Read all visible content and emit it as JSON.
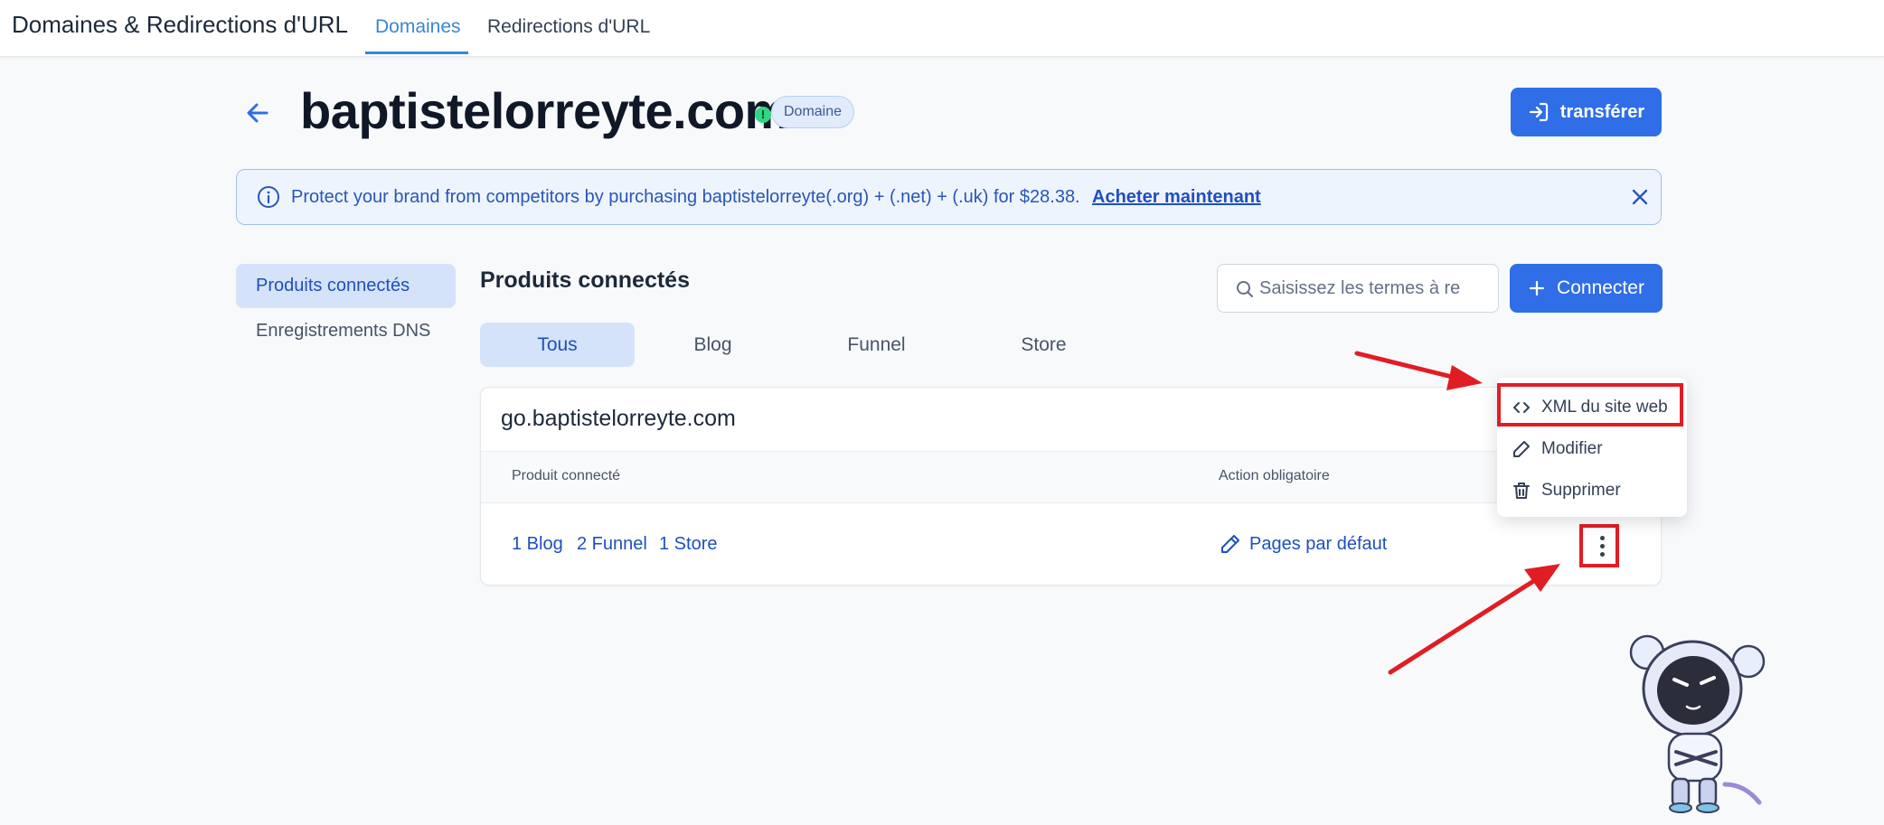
{
  "header": {
    "app_title": "Domaines & Redirections d'URL",
    "tabs": [
      {
        "label": "Domaines",
        "active": true
      },
      {
        "label": "Redirections d'URL",
        "active": false
      }
    ]
  },
  "domain": {
    "name": "baptistelorreyte.com",
    "status_icon": "warning-dot-icon",
    "badge": "Domaine",
    "transfer_label": "transférer"
  },
  "banner": {
    "text": "Protect your brand from competitors by purchasing baptistelorreyte(.org) + (.net) + (.uk) for $28.38.",
    "link": "Acheter maintenant"
  },
  "sidebar": {
    "items": [
      {
        "label": "Produits connectés",
        "active": true
      },
      {
        "label": "Enregistrements DNS",
        "active": false
      }
    ]
  },
  "main": {
    "title": "Produits connectés",
    "search_placeholder": "Saisissez les termes à re",
    "connect_label": "Connecter",
    "filters": [
      {
        "label": "Tous",
        "active": true
      },
      {
        "label": "Blog",
        "active": false
      },
      {
        "label": "Funnel",
        "active": false
      },
      {
        "label": "Store",
        "active": false
      }
    ]
  },
  "card": {
    "domain": "go.baptistelorreyte.com",
    "columns": {
      "product": "Produit connecté",
      "action": "Action obligatoire"
    },
    "products": [
      {
        "label": "1 Blog"
      },
      {
        "label": "2 Funnel"
      },
      {
        "label": "1 Store"
      }
    ],
    "action_label": "Pages par défaut"
  },
  "menu": {
    "items": [
      {
        "label": "XML du site web",
        "icon": "code-icon"
      },
      {
        "label": "Modifier",
        "icon": "pencil-icon"
      },
      {
        "label": "Supprimer",
        "icon": "trash-icon"
      }
    ]
  },
  "colors": {
    "accent": "#2f6ee6",
    "annotation_red": "#e11d24",
    "active_bg": "#d5e3fa"
  }
}
